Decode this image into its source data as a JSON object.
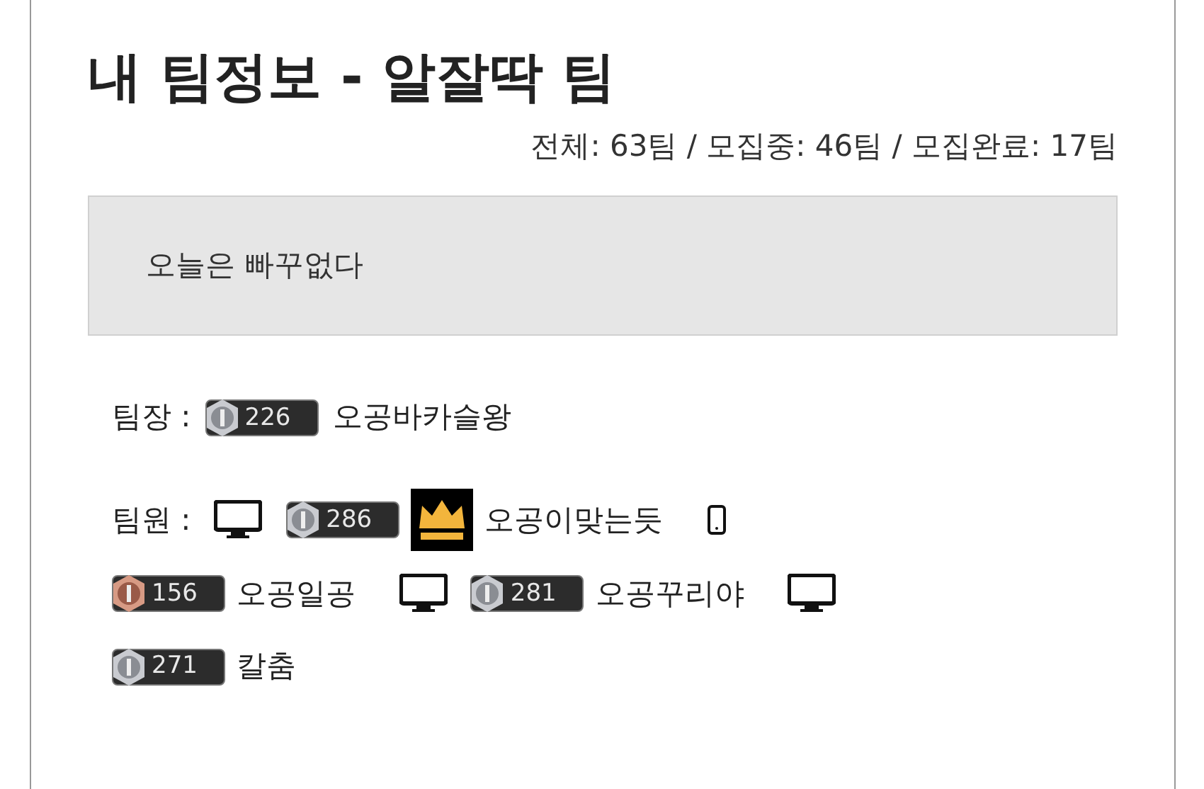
{
  "title": "내 팀정보 - 알잘딱 팀",
  "stats": "전체: 63팀 / 모집중: 46팀 / 모집완료: 17팀",
  "notice": "오늘은 빠꾸없다",
  "leader": {
    "label": "팀장 :",
    "badge": {
      "kind": "silver",
      "level": "226"
    },
    "name": "오공바카슬왕"
  },
  "members_label": "팀원 :",
  "members": [
    {
      "device": {
        "kind": "pc"
      },
      "badge": {
        "kind": "silver",
        "level": "286"
      },
      "crown": true,
      "name": "오공이맞는듯"
    },
    {
      "device": {
        "kind": "mobile"
      },
      "badge": {
        "kind": "bronze",
        "level": "156"
      },
      "crown": false,
      "name": "오공일공"
    },
    {
      "device": {
        "kind": "pc"
      },
      "badge": {
        "kind": "silver",
        "level": "281"
      },
      "crown": false,
      "name": "오공꾸리야"
    },
    {
      "device": {
        "kind": "pc"
      },
      "badge": {
        "kind": "silver",
        "level": "271"
      },
      "crown": false,
      "name": "칼춤"
    }
  ]
}
